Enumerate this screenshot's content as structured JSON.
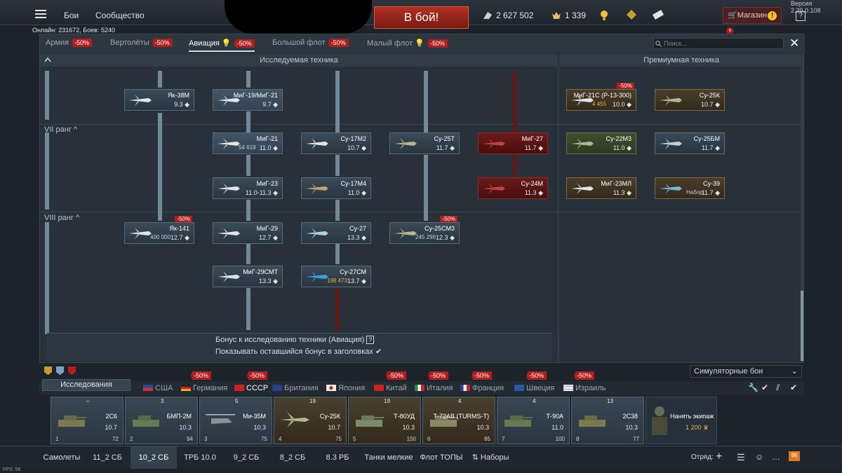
{
  "topbar": {
    "menu_battles": "Бои",
    "menu_community": "Сообщество",
    "online_text": "Онлайн: 231672, Боев: 5240",
    "to_battle": "В бой!",
    "silver_lions": "2 627 502",
    "golden_eagles": "1 339",
    "shop_label": "Магазин",
    "version": "Версия 2.39.0.108",
    "help": "?"
  },
  "tabs": [
    {
      "label": "Армия",
      "discount": "-50%"
    },
    {
      "label": "Вертолёты",
      "discount": "-50%"
    },
    {
      "label": "Авиация",
      "discount": "-50%"
    },
    {
      "label": "Большой флот",
      "discount": "-50%"
    },
    {
      "label": "Малый флот",
      "discount": "-50%"
    }
  ],
  "search_placeholder": "Поиск...",
  "headers": {
    "researchable": "Исследуемая техника",
    "premium": "Премиумная техника"
  },
  "ranks": {
    "vii": "VII ранг",
    "viii": "VIII ранг"
  },
  "vehicles": [
    {
      "name": "Як-38М",
      "br": "9.3",
      "cost": ""
    },
    {
      "name": "МиГ-19/МиГ-21",
      "br": "9.7",
      "cost": ""
    },
    {
      "name": "МиГ-21",
      "br": "11.0",
      "cost": "54 619"
    },
    {
      "name": "МиГ-23",
      "br": "11.0-11.3",
      "cost": ""
    },
    {
      "name": "Як-141",
      "br": "12.7",
      "cost": "400 000",
      "sale": "-50%"
    },
    {
      "name": "МиГ-29",
      "br": "12.7",
      "cost": ""
    },
    {
      "name": "МиГ-29СМТ",
      "br": "13.3",
      "cost": ""
    },
    {
      "name": "Су-17М2",
      "br": "10.7",
      "cost": ""
    },
    {
      "name": "Су-17М4",
      "br": "11.0",
      "cost": ""
    },
    {
      "name": "Су-27",
      "br": "13.3",
      "cost": ""
    },
    {
      "name": "Су-27СМ",
      "br": "13.7",
      "cost": "198 473"
    },
    {
      "name": "Су-25Т",
      "br": "11.7",
      "cost": ""
    },
    {
      "name": "Су-25СМ3",
      "br": "12.3",
      "cost": "245 296",
      "sale": "-50%"
    },
    {
      "name": "МиГ-27",
      "br": "11.7",
      "cost": ""
    },
    {
      "name": "Су-24М",
      "br": "11.3",
      "cost": ""
    },
    {
      "name": "МиГ-21С (Р-13-300)",
      "br": "10.0",
      "cost": "4 455",
      "sale": "-50%"
    },
    {
      "name": "Су-25К",
      "br": "10.7",
      "cost": ""
    },
    {
      "name": "Су-22М3",
      "br": "11.0",
      "cost": ""
    },
    {
      "name": "Су-25БМ",
      "br": "11.7",
      "cost": ""
    },
    {
      "name": "МиГ-23МЛ",
      "br": "11.3",
      "cost": ""
    },
    {
      "name": "Су-39",
      "br": "11.7",
      "cost": "Набор"
    }
  ],
  "bonus": {
    "line1": "Бонус к исследованию техники (Авиация)",
    "line2": "Показывать оставшийся бонус в заголовках",
    "q": "?"
  },
  "mode_select": "Симуляторные бои",
  "research_tab": "Исследования",
  "nation_discount": "-50%",
  "nations": [
    "США",
    "Германия",
    "СССР",
    "Британия",
    "Япония",
    "Китай",
    "Италия",
    "Франция",
    "Швеция",
    "Израиль"
  ],
  "crew_slots": [
    {
      "name": "2С6",
      "br": "10.7",
      "num": "1",
      "exp": "72",
      "count": "–"
    },
    {
      "name": "БМП-2М",
      "br": "10.3",
      "num": "2",
      "exp": "94",
      "count": "3"
    },
    {
      "name": "Ми-35М",
      "br": "10.3",
      "num": "3",
      "exp": "75",
      "count": "5"
    },
    {
      "name": "Су-25К",
      "br": "10.7",
      "num": "4",
      "exp": "75",
      "count": "19"
    },
    {
      "name": "Т-80УД",
      "br": "10.3",
      "num": "5",
      "exp": "150",
      "count": "19"
    },
    {
      "name": "Т-72АВ (TURMS-T)",
      "br": "10.3",
      "num": "6",
      "exp": "85",
      "count": "4"
    },
    {
      "name": "Т-90А",
      "br": "11.0",
      "num": "7",
      "exp": "100",
      "count": "4"
    },
    {
      "name": "2С38",
      "br": "10.3",
      "num": "8",
      "exp": "77",
      "count": "13"
    }
  ],
  "hire_crew": {
    "label": "Нанять экипаж",
    "cost": "1 200"
  },
  "bottom_tabs": [
    "Самолеты",
    "11_2 СБ",
    "10_2 СБ",
    "ТРБ 10.0",
    "9_2 СБ",
    "8_2 СБ",
    "8.3 РБ",
    "Танки мелкие",
    "Флот ТОПЫ",
    "Наборы"
  ],
  "squad_label": "Отряд:",
  "fps": "FPS: 58"
}
